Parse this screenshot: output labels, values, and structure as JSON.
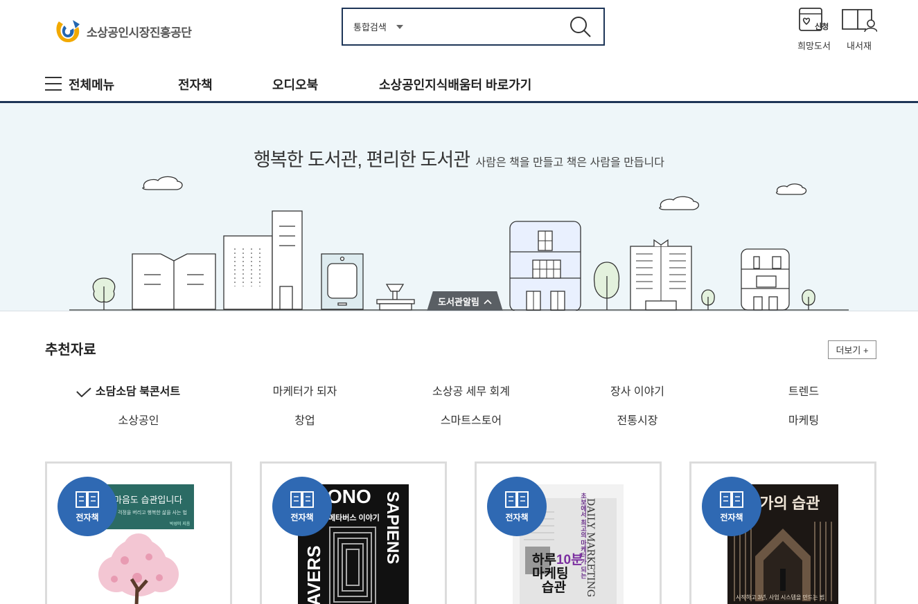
{
  "header": {
    "logo_text": "소상공인시장진흥공단",
    "search": {
      "scope": "통합검색",
      "placeholder": ""
    },
    "utils": [
      {
        "label": "희망도서",
        "icon_badge": "신청"
      },
      {
        "label": "내서재"
      }
    ]
  },
  "nav": {
    "menu_label": "전체메뉴",
    "items": [
      "전자책",
      "오디오북",
      "소상공인지식배움터 바로가기"
    ]
  },
  "hero": {
    "title": "행복한 도서관, 편리한 도서관",
    "subtitle": "사람은 책을 만들고 책은 사람을 만듭니다",
    "notice_tab": "도서관알림"
  },
  "recommend": {
    "title": "추천자료",
    "more": "더보기 +",
    "categories": [
      "소담소담 북콘서트",
      "마케터가 되자",
      "소상공 세무 회계",
      "장사 이야기",
      "트렌드",
      "소상공인",
      "창업",
      "스마트스토어",
      "전통시장",
      "마케팅"
    ],
    "active_category": "소담소담 북콘서트",
    "badge_label": "전자책",
    "books": [
      {
        "cover_title": "마음도 습관입니다",
        "cover_subtitle": "걱정을 버리고 행복한 삶을 사는 법",
        "cover_author": "박성미 지음"
      },
      {
        "cover_title": "메타버스 이야기",
        "cover_top": "ONO",
        "cover_side_left": "TAVERS",
        "cover_side_right": "SAPIENS"
      },
      {
        "cover_title_1": "하루",
        "cover_title_2": "10분",
        "cover_title_3": "마케팅",
        "cover_title_4": "습관",
        "cover_side": "DAILY MARKETING",
        "cover_vertical": "초보에서 최고의 마케터가 되는"
      },
      {
        "cover_title": "업가의 습관",
        "cover_subtitle": "시작하고 3년, 사업 시스템을 만드는 법"
      }
    ]
  },
  "colors": {
    "navy": "#1d3557",
    "badge_blue": "#2f69b3",
    "hero_bg": "#eef6f9"
  }
}
